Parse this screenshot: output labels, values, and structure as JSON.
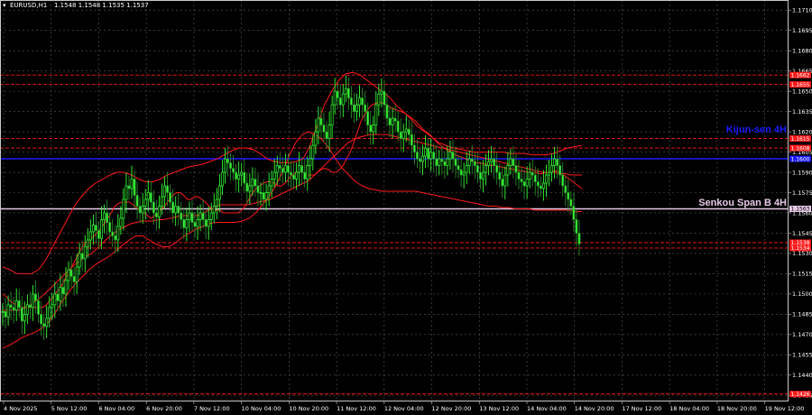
{
  "chart_data": {
    "type": "candlestick",
    "symbol": "EURUSD,H1",
    "ohlc": "1.1548 1.1548 1.1535 1.1537",
    "ylim": [
      1.14205,
      1.17175
    ],
    "y_ticks": [
      "1.1710",
      "1.1695",
      "1.1680",
      "1.1665",
      "1.1650",
      "1.1635",
      "1.1620",
      "1.1605",
      "1.1590",
      "1.1575",
      "1.1560",
      "1.1545",
      "1.1530",
      "1.1515",
      "1.1500",
      "1.1485",
      "1.1470",
      "1.1455",
      "1.1440",
      "1.1425"
    ],
    "x_ticks": [
      "4 Nov 2025",
      "5 Nov 12:00",
      "6 Nov 04:00",
      "6 Nov 20:00",
      "7 Nov 12:00",
      "10 Nov 04:00",
      "10 Nov 20:00",
      "11 Nov 12:00",
      "12 Nov 04:00",
      "12 Nov 20:00",
      "13 Nov 12:00",
      "14 Nov 04:00",
      "14 Nov 20:00",
      "17 Nov 12:00",
      "18 Nov 04:00",
      "18 Nov 20:00",
      "19 Nov 12:00"
    ],
    "levels": [
      {
        "value": 1.1662,
        "label": "1.1662",
        "color": "#ff1a1a",
        "style": "dash"
      },
      {
        "value": 1.1655,
        "label": "1.1655",
        "color": "#ff1a1a",
        "style": "dash"
      },
      {
        "value": 1.1615,
        "label": "1.1615",
        "color": "#ff1a1a",
        "style": "dash"
      },
      {
        "value": 1.1608,
        "label": "1.1608",
        "color": "#ff1a1a",
        "style": "dash"
      },
      {
        "value": 1.16,
        "label": "1.1600",
        "color": "#1a1aff",
        "style": "solid"
      },
      {
        "value": 1.1563,
        "label": "1.1563",
        "color": "#e6c8e6",
        "style": "solid"
      },
      {
        "value": 1.1538,
        "label": "1.1538",
        "color": "#ff1a1a",
        "style": "dash"
      },
      {
        "value": 1.1534,
        "label": "1.1534",
        "color": "#ff1a1a",
        "style": "dash"
      },
      {
        "value": 1.1426,
        "label": "1.1426",
        "color": "#ff1a1a",
        "style": "dash"
      }
    ],
    "annotations": [
      {
        "text": "Kijun-sen 4H",
        "color": "#1a1aff",
        "value": 1.1622
      },
      {
        "text": "Senkou Span B 4H",
        "color": "#e6c8e6",
        "value": 1.1568
      }
    ],
    "close_path": [
      1.1487,
      1.1483,
      1.1492,
      1.149,
      1.1488,
      1.1495,
      1.149,
      1.148,
      1.1485,
      1.1492,
      1.149,
      1.15,
      1.1495,
      1.1485,
      1.1478,
      1.1476,
      1.1482,
      1.149,
      1.1492,
      1.15,
      1.1495,
      1.1505,
      1.15,
      1.151,
      1.1518,
      1.1513,
      1.1509,
      1.152,
      1.153,
      1.1526,
      1.1535,
      1.154,
      1.1546,
      1.1551,
      1.1547,
      1.1541,
      1.1555,
      1.156,
      1.1553,
      1.1546,
      1.1543,
      1.154,
      1.155,
      1.1556,
      1.157,
      1.158,
      1.1578,
      1.1585,
      1.1573,
      1.1565,
      1.156,
      1.1565,
      1.157,
      1.1575,
      1.1568,
      1.156,
      1.1557,
      1.1565,
      1.1572,
      1.158,
      1.1575,
      1.1568,
      1.156,
      1.1565,
      1.156,
      1.1555,
      1.1549,
      1.1555,
      1.156,
      1.1553,
      1.155,
      1.1555,
      1.156,
      1.1555,
      1.155,
      1.1555,
      1.156,
      1.1565,
      1.157,
      1.158,
      1.159,
      1.16,
      1.1597,
      1.1593,
      1.159,
      1.1585,
      1.1588,
      1.159,
      1.1582,
      1.1576,
      1.158,
      1.1585,
      1.158,
      1.1575,
      1.1575,
      1.157,
      1.1575,
      1.158,
      1.1585,
      1.159,
      1.1595,
      1.1593,
      1.159,
      1.1595,
      1.159,
      1.1588,
      1.1585,
      1.159,
      1.1595,
      1.159,
      1.1585,
      1.1595,
      1.16,
      1.161,
      1.162,
      1.163,
      1.1625,
      1.162,
      1.1615,
      1.1625,
      1.164,
      1.165,
      1.1645,
      1.164,
      1.1648,
      1.1652,
      1.1645,
      1.164,
      1.1635,
      1.164,
      1.1645,
      1.164,
      1.1635,
      1.1625,
      1.162,
      1.1625,
      1.164,
      1.1648,
      1.165,
      1.164,
      1.163,
      1.1625,
      1.163,
      1.1628,
      1.162,
      1.1615,
      1.162,
      1.1622,
      1.1618,
      1.161,
      1.1605,
      1.16,
      1.1598,
      1.1602,
      1.1608,
      1.16,
      1.1605,
      1.16,
      1.1595,
      1.16,
      1.1598,
      1.1595,
      1.16,
      1.1605,
      1.16,
      1.1595,
      1.1592,
      1.1588,
      1.159,
      1.1595,
      1.16,
      1.1598,
      1.1595,
      1.159,
      1.1585,
      1.159,
      1.1595,
      1.1598,
      1.16,
      1.1595,
      1.159,
      1.1585,
      1.158,
      1.1588,
      1.1595,
      1.16,
      1.1595,
      1.159,
      1.1585,
      1.1583,
      1.158,
      1.1585,
      1.159,
      1.1588,
      1.1583,
      1.158,
      1.1578,
      1.1582,
      1.1588,
      1.159,
      1.1595,
      1.16,
      1.1595,
      1.1588,
      1.158,
      1.1575,
      1.157,
      1.1565,
      1.1555,
      1.1545,
      1.1537
    ],
    "tenkan": [
      1.15,
      1.1498,
      1.1495,
      1.1493,
      1.1492,
      1.149,
      1.149,
      1.149,
      1.149,
      1.149,
      1.149,
      1.149,
      1.1492,
      1.1495,
      1.1498,
      1.1502,
      1.1505,
      1.151,
      1.1515,
      1.152,
      1.1525,
      1.153,
      1.1535,
      1.1538,
      1.154,
      1.1542,
      1.1545,
      1.1548,
      1.1552,
      1.1556,
      1.156,
      1.1565,
      1.1567,
      1.1568,
      1.1568,
      1.1568,
      1.1566,
      1.1564,
      1.1562,
      1.156,
      1.1558,
      1.1556,
      1.1558,
      1.156,
      1.1563,
      1.1566,
      1.157,
      1.1573,
      1.1575,
      1.1575,
      1.1573,
      1.157,
      1.157,
      1.1572,
      1.1572,
      1.157,
      1.1568,
      1.1565,
      1.1563,
      1.1562,
      1.1562,
      1.156,
      1.156,
      1.156,
      1.156,
      1.156,
      1.1562,
      1.1565,
      1.157,
      1.1575,
      1.1578,
      1.158,
      1.1582,
      1.1583,
      1.1583,
      1.1582,
      1.158,
      1.158,
      1.1582,
      1.1585,
      1.1588,
      1.159,
      1.159,
      1.159,
      1.1588,
      1.1588,
      1.1588,
      1.159,
      1.1592,
      1.1593,
      1.1592,
      1.159,
      1.159,
      1.1592,
      1.1595,
      1.16,
      1.1605,
      1.1612,
      1.162,
      1.1628,
      1.1633,
      1.1637,
      1.164,
      1.1641,
      1.1642,
      1.1641,
      1.164,
      1.1638,
      1.1637,
      1.1636,
      1.1635,
      1.1634,
      1.1632,
      1.163,
      1.1628,
      1.1625,
      1.1622,
      1.162,
      1.1618,
      1.1615,
      1.1612,
      1.161,
      1.1608,
      1.1606,
      1.1605,
      1.1603,
      1.1602,
      1.1601,
      1.16,
      1.1599,
      1.1598,
      1.1597,
      1.1597,
      1.1596,
      1.1596,
      1.1595,
      1.1595,
      1.1594,
      1.1594,
      1.1593,
      1.1593,
      1.1592,
      1.1592,
      1.1591,
      1.1591,
      1.159,
      1.159,
      1.159,
      1.1589,
      1.1589,
      1.159,
      1.159,
      1.1591,
      1.1591,
      1.159,
      1.1588,
      1.1586,
      1.1584,
      1.1582,
      1.158,
      1.1578
    ],
    "kijun": [
      1.1488,
      1.1488,
      1.1488,
      1.1488,
      1.149,
      1.1492,
      1.1495,
      1.1498,
      1.1502,
      1.1506,
      1.151,
      1.1514,
      1.1518,
      1.1522,
      1.1525,
      1.1528,
      1.153,
      1.1534,
      1.1538,
      1.1542,
      1.1545,
      1.1548,
      1.155,
      1.1552,
      1.1553,
      1.1554,
      1.1554,
      1.1554,
      1.1555,
      1.1555,
      1.1556,
      1.1557,
      1.1558,
      1.1558,
      1.1558,
      1.1558,
      1.156,
      1.1562,
      1.1564,
      1.1566,
      1.1566,
      1.1566,
      1.1566,
      1.1566,
      1.1566,
      1.1567,
      1.1568,
      1.1569,
      1.157,
      1.1572,
      1.1574,
      1.1576,
      1.1578,
      1.158,
      1.1582,
      1.1584,
      1.1588,
      1.1592,
      1.1596,
      1.16,
      1.1604,
      1.1608,
      1.1612,
      1.1614,
      1.1616,
      1.1617,
      1.1618,
      1.1618,
      1.1618,
      1.1618,
      1.1617,
      1.1616,
      1.1615,
      1.1614,
      1.1613,
      1.1612,
      1.1611,
      1.161,
      1.1609,
      1.1608,
      1.1607,
      1.1606,
      1.1605,
      1.1604,
      1.1603,
      1.1602,
      1.1601,
      1.16,
      1.1599,
      1.1598,
      1.1597,
      1.1596,
      1.1595,
      1.1594,
      1.1593,
      1.1592,
      1.1591,
      1.159,
      1.159,
      1.159,
      1.1589,
      1.1589,
      1.1588,
      1.1588,
      1.1588
    ],
    "bb_upper": [
      1.152,
      1.1518,
      1.1515,
      1.1515,
      1.1515,
      1.1518,
      1.1525,
      1.1535,
      1.1545,
      1.1555,
      1.1565,
      1.1572,
      1.1578,
      1.1582,
      1.1585,
      1.1588,
      1.159,
      1.159,
      1.1588,
      1.1585,
      1.1583,
      1.1583,
      1.1585,
      1.1588,
      1.159,
      1.1592,
      1.1594,
      1.1595,
      1.1596,
      1.1598,
      1.16,
      1.1603,
      1.1606,
      1.1608,
      1.1608,
      1.1607,
      1.1604,
      1.16,
      1.1598,
      1.1597,
      1.1597,
      1.1598,
      1.16,
      1.161,
      1.1625,
      1.164,
      1.165,
      1.1658,
      1.1663,
      1.1664,
      1.1662,
      1.1658,
      1.1654,
      1.165,
      1.1646,
      1.164,
      1.1635,
      1.163,
      1.1624,
      1.162,
      1.1616,
      1.1612,
      1.161,
      1.1608,
      1.1607,
      1.1606,
      1.1605,
      1.1605,
      1.1605,
      1.1605,
      1.1605,
      1.1604,
      1.1604,
      1.1604,
      1.1603,
      1.1603,
      1.1603,
      1.1604,
      1.1606,
      1.1608,
      1.1609,
      1.161
    ],
    "bb_lower": [
      1.146,
      1.1462,
      1.1465,
      1.1468,
      1.147,
      1.1472,
      1.1475,
      1.148,
      1.1487,
      1.1495,
      1.1502,
      1.1508,
      1.1513,
      1.1518,
      1.1522,
      1.1525,
      1.1528,
      1.1532,
      1.1536,
      1.154,
      1.1543,
      1.1543,
      1.154,
      1.1537,
      1.1535,
      1.1535,
      1.1538,
      1.1542,
      1.1545,
      1.1548,
      1.155,
      1.1552,
      1.1553,
      1.1553,
      1.1553,
      1.1553,
      1.1554,
      1.1556,
      1.156,
      1.1566,
      1.1572,
      1.158,
      1.159,
      1.1602,
      1.1612,
      1.1618,
      1.162,
      1.1618,
      1.1614,
      1.1608,
      1.16,
      1.1593,
      1.1588,
      1.1583,
      1.158,
      1.1578,
      1.1577,
      1.1576,
      1.1576,
      1.1576,
      1.1576,
      1.1576,
      1.1576,
      1.1575,
      1.1574,
      1.1573,
      1.1572,
      1.1571,
      1.157,
      1.1569,
      1.1568,
      1.1567,
      1.1566,
      1.1565,
      1.1565,
      1.1564,
      1.1564,
      1.1563,
      1.1563,
      1.1563,
      1.1562,
      1.1562,
      1.1562,
      1.1562,
      1.1562,
      1.1562,
      1.1561,
      1.1561
    ]
  }
}
